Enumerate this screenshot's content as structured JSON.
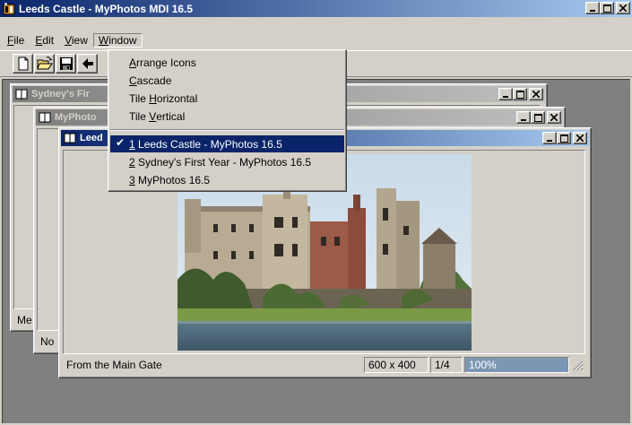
{
  "app": {
    "title": "Leeds Castle - MyPhotos MDI 16.5"
  },
  "menubar": {
    "items": [
      {
        "label": "File",
        "accel": "F",
        "rest": "ile"
      },
      {
        "label": "Edit",
        "accel": "E",
        "rest": "dit"
      },
      {
        "label": "View",
        "accel": "V",
        "rest": "iew"
      },
      {
        "label": "Window",
        "accel": "W",
        "rest": "indow"
      }
    ]
  },
  "window_menu": {
    "items": [
      {
        "pre": "",
        "accel": "A",
        "rest": "rrange Icons"
      },
      {
        "pre": "",
        "accel": "C",
        "rest": "ascade"
      },
      {
        "pre": "Tile ",
        "accel": "H",
        "rest": "orizontal"
      },
      {
        "pre": "Tile ",
        "accel": "V",
        "rest": "ertical"
      }
    ],
    "windows": [
      {
        "accel": "1",
        "rest": " Leeds Castle - MyPhotos 16.5",
        "checked": true
      },
      {
        "accel": "2",
        "rest": " Sydney's First Year - MyPhotos 16.5",
        "checked": false
      },
      {
        "accel": "3",
        "rest": " MyPhotos 16.5",
        "checked": false
      }
    ]
  },
  "children": {
    "sydney": {
      "title": "Sydney's Fir",
      "status_left": "Me"
    },
    "myphotos": {
      "title": "MyPhoto",
      "status_left": "No"
    },
    "leeds": {
      "title": "Leed",
      "status": {
        "caption": "From the Main Gate",
        "size": "600 x 400",
        "index": "1/4",
        "zoom": "100%"
      },
      "zoom_fraction": 1.0
    }
  },
  "colors": {
    "active_title": "#0a246a",
    "face": "#d4d0c8",
    "mdi_background": "#808080"
  }
}
